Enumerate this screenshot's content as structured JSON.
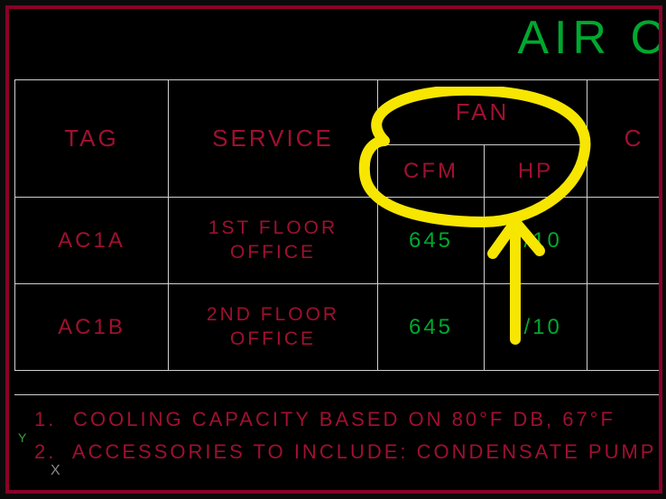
{
  "title": "AIR C",
  "headers": {
    "tag": "TAG",
    "service": "SERVICE",
    "fan": "FAN",
    "cfm": "CFM",
    "hp": "HP",
    "c": "C"
  },
  "rows": [
    {
      "tag": "AC1A",
      "service_l1": "1ST FLOOR",
      "service_l2": "OFFICE",
      "cfm": "645",
      "hp": "1/10",
      "c": ""
    },
    {
      "tag": "AC1B",
      "service_l1": "2ND FLOOR",
      "service_l2": "OFFICE",
      "cfm": "645",
      "hp": "1/10",
      "c": ""
    }
  ],
  "notes": {
    "n1_num": "1.",
    "n1_text": "COOLING CAPACITY BASED ON 80°F DB, 67°F",
    "n2_num": "2.",
    "n2_text": "ACCESSORIES TO INCLUDE: CONDENSATE PUMP"
  },
  "axis": {
    "y": "Y",
    "x": "X"
  }
}
